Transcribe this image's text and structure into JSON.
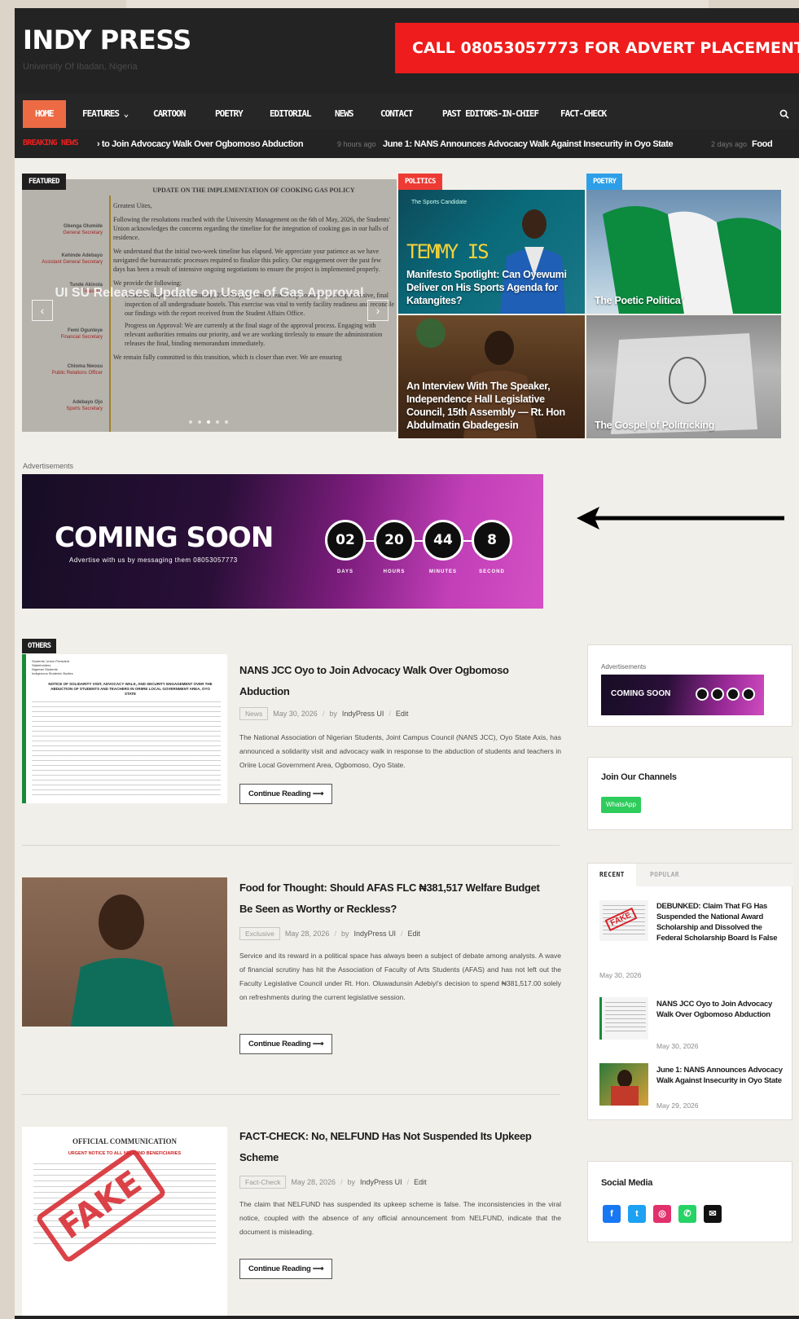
{
  "site": {
    "title": "INDY PRESS",
    "tagline": "University Of Ibadan, Nigeria",
    "advert_text": "CALL 08053057773 FOR ADVERT PLACEMENT"
  },
  "nav": {
    "items": [
      {
        "label": "HOME",
        "active": true
      },
      {
        "label": "FEATURES ⌄"
      },
      {
        "label": "CARTOON"
      },
      {
        "label": "POETRY"
      },
      {
        "label": "EDITORIAL"
      },
      {
        "label": "NEWS"
      },
      {
        "label": "CONTACT"
      },
      {
        "label": "PAST EDITORS-IN-CHIEF"
      },
      {
        "label": "FACT-CHECK"
      }
    ],
    "search_icon": "search-icon"
  },
  "breaking": {
    "label": "BREAKING NEWS",
    "items": [
      {
        "text": "to Join Advocacy Walk Over Ogbomoso Abduction",
        "time": "9 hours ago"
      },
      {
        "text": "June 1: NANS Announces Advocacy Walk Against Insecurity in Oyo State",
        "time": "2 days ago"
      },
      {
        "text": "Food"
      }
    ]
  },
  "featured": {
    "tag": "FEATURED",
    "slide_title": "UI SU Releases Update on Usage of Gas Approval",
    "doc": {
      "heading": "UPDATE ON THE IMPLEMENTATION OF COOKING GAS POLICY",
      "greeting": "Greatest Uites,",
      "p1": "Following the resolutions reached with the University Management on the 6th of May, 2026, the Students' Union acknowledges the concerns regarding the timeline for the integration of cooking gas in our halls of residence.",
      "p2": "We understand that the initial two-week timeline has elapsed. We appreciate your patience as we have navigated the bureaucratic processes required to finalize this policy. Our engagement over the past few days has been a result of intensive ongoing negotiations to ensure the project is implemented properly.",
      "p3": "We provide the following:",
      "b1": "Finalized Inspection: On Saturday, 23rd May, the Union leadership conducted a comprehensive, final inspection of all undergraduate hostels. This exercise was vital to verify facility readiness and reconcile our findings with the report received from the Student Affairs Office.",
      "b2": "Progress on Approval: We are currently at the final stage of the approval process. Engaging with relevant authorities remains our priority, and we are working tirelessly to ensure the administration releases the final, binding memorandum immediately.",
      "p4": "We remain fully committed to this transition, which is closer than ever. We are ensuring",
      "sigs": [
        {
          "name": "Gbenga Olumide",
          "role": "General Secretary"
        },
        {
          "name": "Kehinde Adebayo",
          "role": "Assistant General Secretary"
        },
        {
          "name": "Tunde Akinola",
          "role": "Treasurer"
        },
        {
          "name": "Femi Ogunleye",
          "role": "Financial Secretary"
        },
        {
          "name": "Chioma Nwosu",
          "role": "Public Relations Officer"
        },
        {
          "name": "Adebayo Ojo",
          "role": "Sports Secretary"
        }
      ]
    },
    "prev_icon": "chevron-left-icon",
    "next_icon": "chevron-right-icon"
  },
  "cards": [
    {
      "tag": "POLITICS",
      "tag_color": "#ee3a34",
      "title": "Manifesto Spotlight: Can Oyewumi Deliver on His Sports Agenda for Katangites?",
      "overlay_word": "TEMMY IS",
      "top_label": "The Sports Candidate"
    },
    {
      "tag": "POETRY",
      "tag_color": "#2c9fe8",
      "title": "The Poetic Politica’"
    },
    {
      "title": "An Interview With The Speaker, Independence Hall Legislative Council, 15th Assembly — Rt. Hon Abdulmatin Gbadegesin"
    },
    {
      "title": "The Gospel of Politricking"
    }
  ],
  "ad": {
    "label": "Advertisements",
    "headline": "COMING SOON",
    "subline": "Advertise with us by messaging them 08053057773",
    "countdown": [
      {
        "value": "02",
        "label": "DAYS"
      },
      {
        "value": "20",
        "label": "HOURS"
      },
      {
        "value": "44",
        "label": "MINUTES"
      },
      {
        "value": "8",
        "label": "SECOND"
      }
    ]
  },
  "others_tag": "OTHERS",
  "posts": [
    {
      "title": "NANS JCC Oyo to Join Advocacy Walk Over Ogbomoso Abduction",
      "category": "News",
      "date": "May 30, 2026",
      "by": "by",
      "author": "IndyPress UI",
      "edit": "Edit",
      "excerpt": "The National Association of Nigerian Students, Joint Campus Council (NANS JCC), Oyo State Axis, has announced a solidarity visit and advocacy walk in response to the abduction of students and teachers in Oriire Local Government Area, Ogbomoso, Oyo State.",
      "button": "Continue Reading ⟶",
      "thumb_doc": {
        "header": "Students' Union President\nStakeholders\nNigerian Students\nIndigenous Students' Bodies",
        "title": "NOTICE OF SOLIDARITY VISIT, ADVOCACY WALK, AND SECURITY ENGAGEMENT OVER THE ABDUCTION OF STUDENTS AND TEACHERS IN ORIIRE LOCAL GOVERNMENT AREA, OYO STATE"
      }
    },
    {
      "title": "Food for Thought: Should AFAS FLC ₦381,517 Welfare Budget Be Seen as Worthy or Reckless?",
      "category": "Exclusive",
      "date": "May 28, 2026",
      "by": "by",
      "author": "IndyPress UI",
      "edit": "Edit",
      "excerpt": "Service and its reward in a political space has always been a subject of debate among analysts. A wave of financial scrutiny has hit the Association of Faculty of Arts Students (AFAS) and has not left out the Faculty Legislative Council under Rt. Hon. Oluwadunsin Adebiyi's decision to spend ₦381,517.00 solely on refreshments during the current legislative session.",
      "button": "Continue Reading ⟶"
    },
    {
      "title": "FACT-CHECK: No, NELFUND Has Not Suspended Its Upkeep Scheme",
      "category": "Fact-Check",
      "date": "May 28, 2026",
      "by": "by",
      "author": "IndyPress UI",
      "edit": "Edit",
      "excerpt": "The claim that NELFUND has suspended its upkeep scheme is false. The inconsistencies in the viral notice, coupled with the absence of any official announcement from NELFUND, indicate that the document is misleading.",
      "button": "Continue Reading ⟶",
      "thumb_doc": {
        "title": "OFFICIAL COMMUNICATION",
        "subtitle": "URGENT NOTICE TO ALL NELFUND BENEFICIARIES",
        "stamp": "FAKE"
      }
    }
  ],
  "sidebar": {
    "ad_label": "Advertisements",
    "ad_headline": "COMING SOON",
    "channels_title": "Join Our Channels",
    "whatsapp_label": "WhatsApp",
    "tabs": [
      "RECENT",
      "POPULAR"
    ],
    "recent": [
      {
        "title": "DEBUNKED: Claim That FG Has Suspended the National Award Scholarship and Dissolved the Federal Scholarship Board Is False",
        "date": "May 30, 2026",
        "stamp": "FAKE"
      },
      {
        "title": "NANS JCC Oyo to Join Advocacy Walk Over Ogbomoso Abduction",
        "date": "May 30, 2026"
      },
      {
        "title": "June 1: NANS Announces Advocacy Walk Against Insecurity in Oyo State",
        "date": "May 29, 2026"
      }
    ],
    "social_title": "Social Media",
    "social": [
      {
        "icon": "facebook-icon",
        "glyph": "f",
        "color": "#1877f2"
      },
      {
        "icon": "twitter-icon",
        "glyph": "t",
        "color": "#1da1f2"
      },
      {
        "icon": "instagram-icon",
        "glyph": "◎",
        "color": "#e1306c"
      },
      {
        "icon": "whatsapp-icon",
        "glyph": "✆",
        "color": "#25d366"
      },
      {
        "icon": "email-icon",
        "glyph": "✉",
        "color": "#111111"
      }
    ]
  }
}
